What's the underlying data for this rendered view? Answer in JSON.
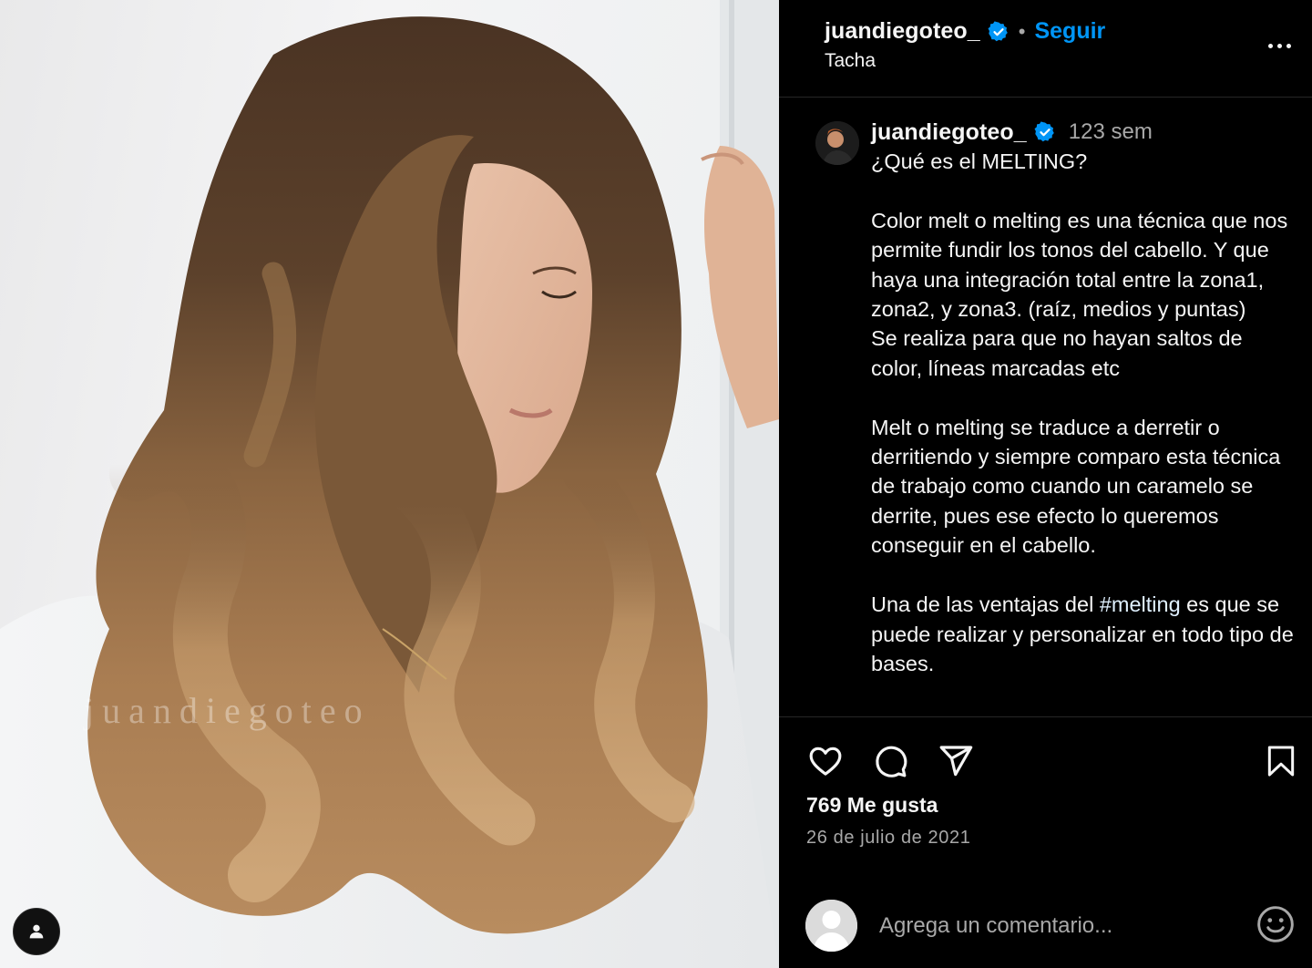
{
  "header": {
    "username": "juandiegoteo_",
    "separator": "•",
    "follow_label": "Seguir",
    "location": "Tacha",
    "more_icon": "more-options-icon"
  },
  "media": {
    "watermark": "juandiegoteo",
    "tag_icon": "user-tag-icon"
  },
  "caption": {
    "username": "juandiegoteo_",
    "time": "123 sem",
    "text_before_hashtag": "¿Qué es el MELTING?\n\nColor melt o melting es una técnica que nos permite fundir los tonos del cabello. Y que haya una integración total entre la zona1, zona2, y zona3. (raíz, medios y puntas)\nSe realiza para que no hayan saltos de color, líneas marcadas etc\n\nMelt o melting se traduce a derretir o derritiendo y siempre comparo esta técnica de trabajo como cuando un caramelo se derrite, pues ese efecto lo queremos conseguir en el cabello.\n\nUna de las ventajas del ",
    "hashtag": "#melting",
    "text_after_hashtag": " es que se puede realizar y personalizar en todo tipo de bases."
  },
  "actions": {
    "like_icon": "heart-icon",
    "comment_icon": "comment-icon",
    "share_icon": "send-icon",
    "save_icon": "bookmark-icon"
  },
  "stats": {
    "likes": "769 Me gusta",
    "date": "26 de julio de 2021"
  },
  "comment_box": {
    "placeholder": "Agrega un comentario...",
    "emoji_icon": "emoji-icon"
  },
  "colors": {
    "background": "#000000",
    "text": "#f5f5f5",
    "secondary_text": "#a8a8a8",
    "follow_blue": "#0095f6",
    "verified_blue": "#0095f6",
    "divider": "#262626"
  }
}
